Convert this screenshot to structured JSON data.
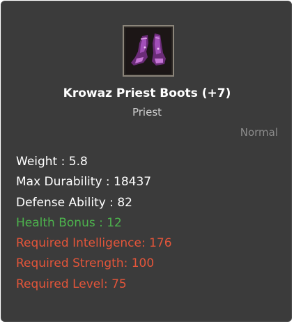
{
  "item": {
    "icon": "purple-priest-boots-icon",
    "name": "Krowaz Priest Boots (+7)",
    "class": "Priest",
    "grade": "Normal"
  },
  "stats": [
    {
      "text": "Weight : 5.8",
      "color": "#ffffff"
    },
    {
      "text": "Max Durability : 18437",
      "color": "#ffffff"
    },
    {
      "text": "Defense Ability : 82",
      "color": "#ffffff"
    },
    {
      "text": "Health Bonus : 12",
      "color": "#4db34d"
    },
    {
      "text": "Required Intelligence: 176",
      "color": "#e4553a"
    },
    {
      "text": "Required Strength: 100",
      "color": "#e4553a"
    },
    {
      "text": "Required Level: 75",
      "color": "#e4553a"
    }
  ]
}
